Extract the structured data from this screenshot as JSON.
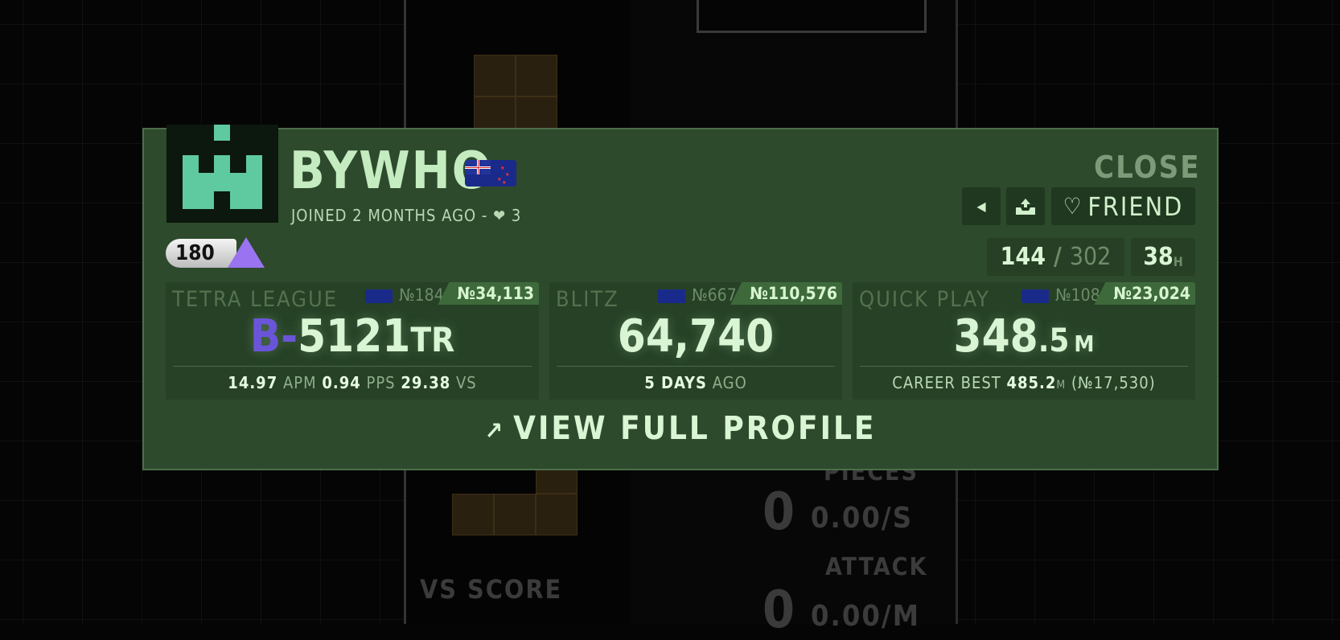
{
  "background": {
    "vs_score_label": "VS SCORE",
    "pieces_label": "PIECES",
    "pieces_value": "0",
    "pieces_rate": "0.00/S",
    "attack_label": "ATTACK",
    "attack_value": "0",
    "attack_rate": "0.00/M"
  },
  "profile": {
    "username": "BYWHO",
    "flag_icon": "new-zealand-flag",
    "joined": "JOINED 2 MONTHS AGO",
    "separator": "-",
    "hearts": "3",
    "close_label": "CLOSE",
    "friend_label": "FRIEND",
    "level": "180",
    "achievement_count": "144",
    "achievement_total": "302",
    "hours": "38",
    "hours_unit": "H",
    "accent": "#5fc9a0"
  },
  "tetra_league": {
    "title": "TETRA LEAGUE",
    "country_rank": "№184",
    "global_rank": "№34,113",
    "rank_letter": "B-",
    "tr_value": "5121",
    "tr_unit": "TR",
    "apm": "14.97",
    "apm_label": "APM",
    "pps": "0.94",
    "pps_label": "PPS",
    "vs": "29.38",
    "vs_label": "VS"
  },
  "blitz": {
    "title": "BLITZ",
    "country_rank": "№667",
    "global_rank": "№110,576",
    "score": "64,740",
    "when": "5 DAYS",
    "ago": "AGO"
  },
  "quick_play": {
    "title": "QUICK PLAY",
    "country_rank": "№108",
    "global_rank": "№23,024",
    "altitude_int": "348",
    "altitude_dec": ".5",
    "altitude_unit": "M",
    "career_label": "CAREER BEST",
    "career_value": "485.2",
    "career_unit": "M",
    "career_rank": "(№17,530)"
  },
  "footer": {
    "view_label": "VIEW FULL PROFILE"
  }
}
